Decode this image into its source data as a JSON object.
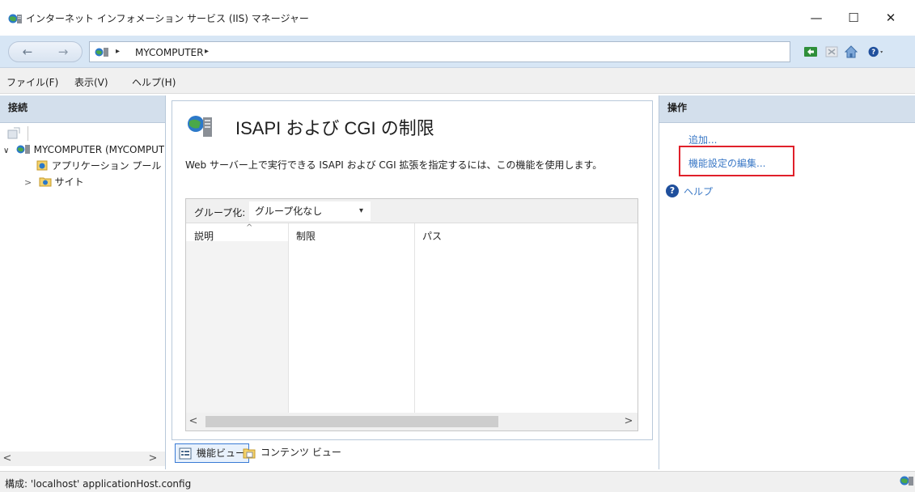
{
  "window": {
    "title": "インターネット インフォメーション サービス (IIS) マネージャー",
    "minimize": "—",
    "maximize": "☐",
    "close": "✕"
  },
  "address": {
    "back": "←",
    "forward": "→",
    "separator": "▸",
    "node": "MYCOMPUTER",
    "toolbar_icons": [
      "connect-icon",
      "stop-icon",
      "home-icon",
      "help-icon"
    ]
  },
  "menu": {
    "items": [
      "ファイル(F)",
      "表示(V)",
      "ヘルプ(H)"
    ]
  },
  "connections": {
    "header": "接続",
    "tree": [
      {
        "label": "MYCOMPUTER (MYCOMPUTER\\)",
        "expander": "∨"
      },
      {
        "label": "アプリケーション プール",
        "expander": ""
      },
      {
        "label": "サイト",
        "expander": ">"
      }
    ],
    "scroll_left": "<",
    "scroll_right": ">"
  },
  "feature": {
    "title": "ISAPI および CGI の制限",
    "description": "Web サーバー上で実行できる ISAPI および CGI 拡張を指定するには、この機能を使用します。",
    "group_label": "グループ化:",
    "group_value": "グループ化なし",
    "group_caret": "▾",
    "columns": [
      "説明",
      "制限",
      "パス"
    ],
    "sort_indicator": "^",
    "scroll_left": "<",
    "scroll_right": ">"
  },
  "view_tabs": {
    "features": "機能ビュー",
    "content": "コンテンツ ビュー"
  },
  "actions": {
    "header": "操作",
    "add": "追加...",
    "edit_settings": "機能設定の編集...",
    "help": "ヘルプ",
    "help_glyph": "?"
  },
  "status": {
    "text": "構成: 'localhost' applicationHost.config"
  },
  "colors": {
    "accent": "#3a78c6",
    "highlight_box": "#e0202a",
    "pane_header": "#d3dfec",
    "address_bar": "#d7e6f5"
  }
}
